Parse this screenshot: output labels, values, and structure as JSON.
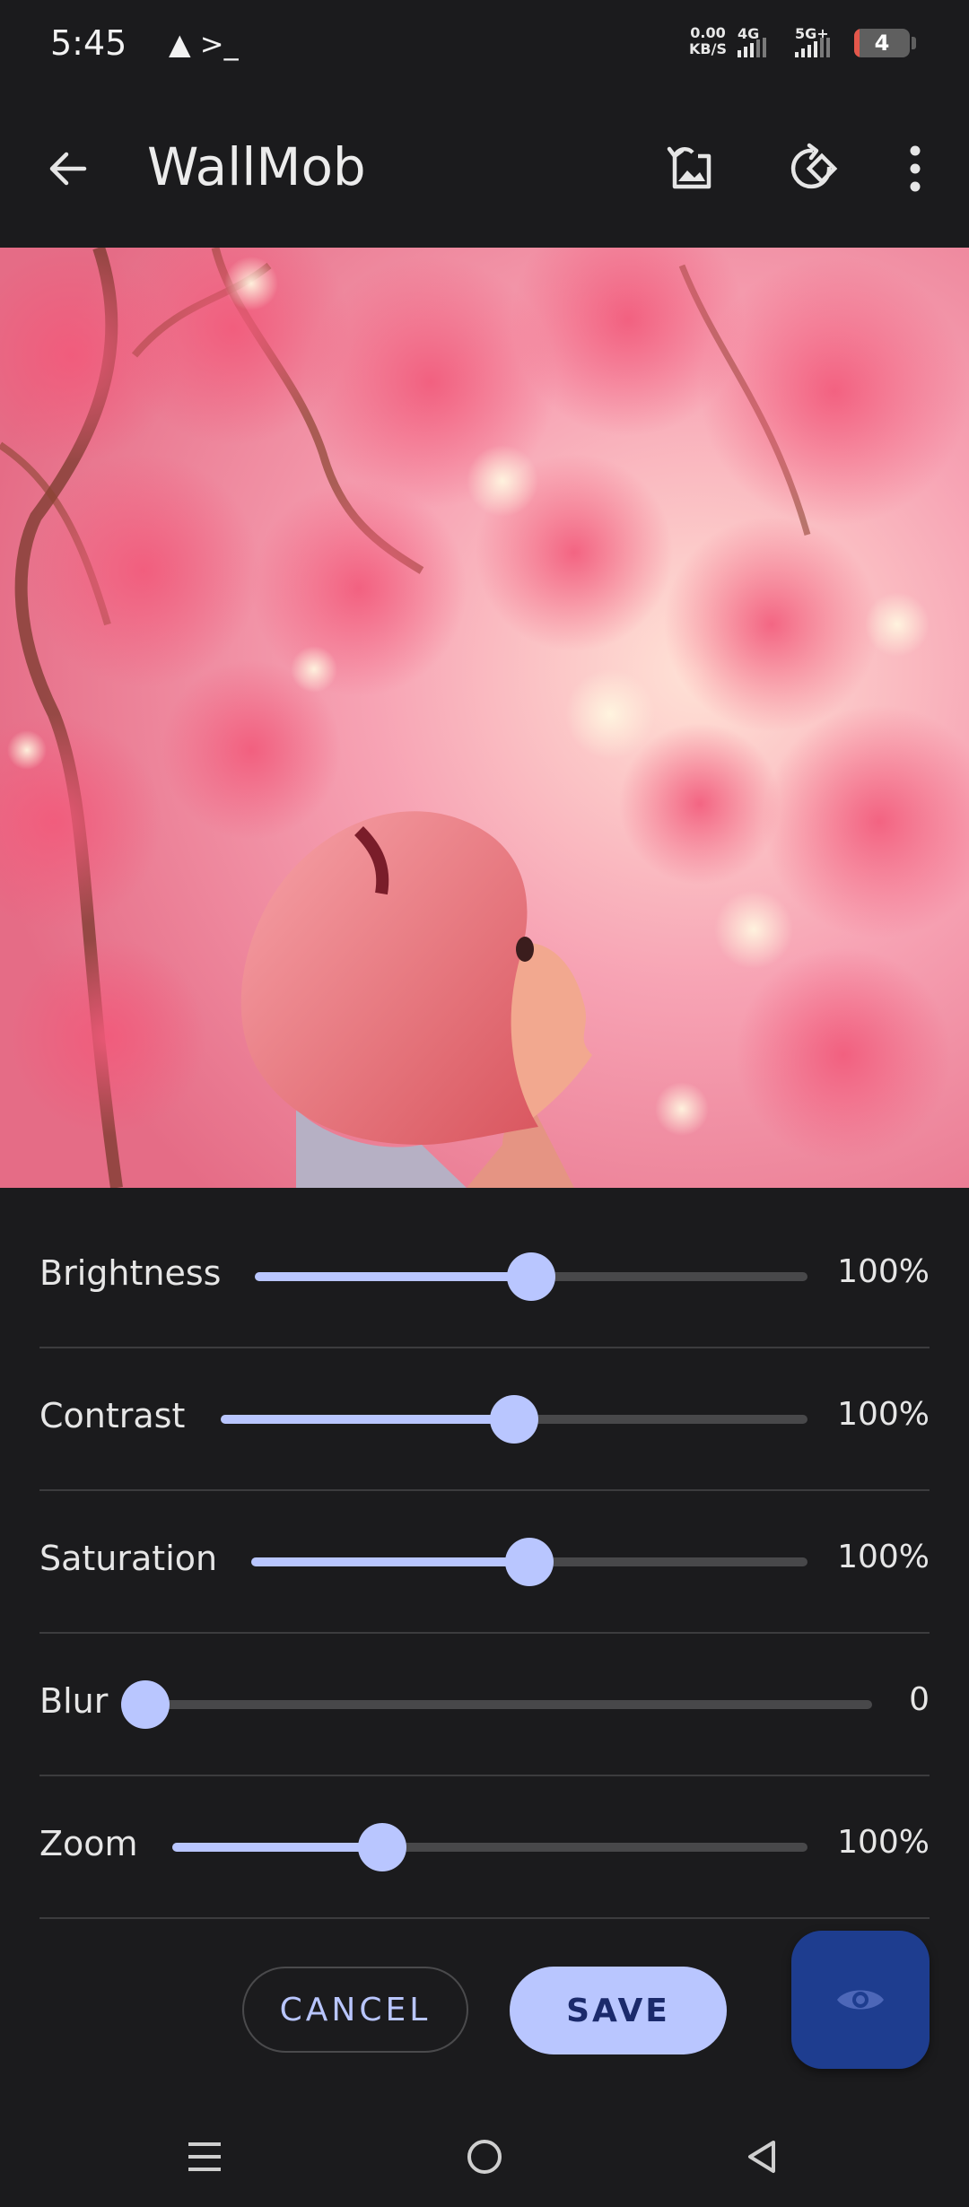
{
  "status_bar": {
    "time": "5:45",
    "glyphs": "▲ >_",
    "net_speed_value": "0.00",
    "net_speed_unit": "KB/S",
    "signal_1_label": "4G",
    "signal_2_label": "5G+",
    "battery_level": "4"
  },
  "app_bar": {
    "title": "WallMob",
    "back_icon": "arrow-left-icon",
    "reset_icon": "restore-image-icon",
    "rotate_icon": "rotate-icon",
    "menu_icon": "more-vert-icon"
  },
  "preview": {
    "description_icon": "wallpaper-preview-image"
  },
  "adjustments": [
    {
      "label": "Brightness",
      "value": "100%",
      "fraction": 0.5
    },
    {
      "label": "Contrast",
      "value": "100%",
      "fraction": 0.5
    },
    {
      "label": "Saturation",
      "value": "100%",
      "fraction": 0.5
    },
    {
      "label": "Blur",
      "value": "0",
      "fraction": 0.0
    },
    {
      "label": "Zoom",
      "value": "100%",
      "fraction": 0.33
    }
  ],
  "actions": {
    "cancel_label": "CANCEL",
    "save_label": "SAVE",
    "preview_icon": "eye-icon"
  },
  "nav_bar": {
    "recents_icon": "menu-lines-icon",
    "home_icon": "circle-home-icon",
    "back_icon": "triangle-back-icon"
  },
  "colors": {
    "background": "#1b1b1d",
    "accent": "#b9c6ff",
    "track": "#48484a",
    "fab": "#1e3d8f"
  }
}
